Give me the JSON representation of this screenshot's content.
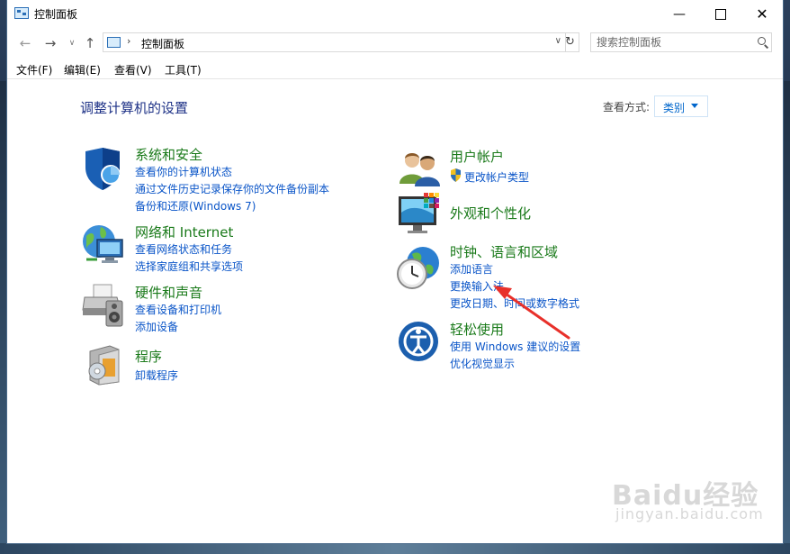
{
  "window": {
    "title": "控制面板"
  },
  "address": {
    "path": "控制面板",
    "search_placeholder": "搜索控制面板"
  },
  "menu": [
    "文件(F)",
    "编辑(E)",
    "查看(V)",
    "工具(T)"
  ],
  "page": {
    "title": "调整计算机的设置",
    "view_by_label": "查看方式:",
    "view_by_value": "类别"
  },
  "categories": {
    "system": {
      "title": "系统和安全",
      "links": [
        "查看你的计算机状态",
        "通过文件历史记录保存你的文件备份副本",
        "备份和还原(Windows 7)"
      ]
    },
    "network": {
      "title": "网络和 Internet",
      "links": [
        "查看网络状态和任务",
        "选择家庭组和共享选项"
      ]
    },
    "hardware": {
      "title": "硬件和声音",
      "links": [
        "查看设备和打印机",
        "添加设备"
      ]
    },
    "programs": {
      "title": "程序",
      "links": [
        "卸载程序"
      ]
    },
    "users": {
      "title": "用户帐户",
      "links": [
        "更改帐户类型"
      ]
    },
    "appearance": {
      "title": "外观和个性化",
      "links": []
    },
    "clock": {
      "title": "时钟、语言和区域",
      "links": [
        "添加语言",
        "更换输入法",
        "更改日期、时间或数字格式"
      ]
    },
    "ease": {
      "title": "轻松使用",
      "links": [
        "使用 Windows 建议的设置",
        "优化视觉显示"
      ]
    }
  },
  "watermark": {
    "logo": "Baidu经验",
    "url": "jingyan.baidu.com"
  },
  "colors": {
    "title": "#1e3287",
    "category": "#1a7a1a",
    "link": "#0a55c8",
    "annotation": "#e8302a"
  }
}
